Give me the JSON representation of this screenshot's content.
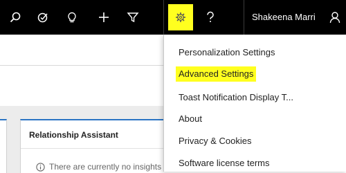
{
  "topbar": {
    "icons": [
      "search-icon",
      "tasks-icon",
      "lightbulb-icon",
      "plus-icon",
      "filter-icon",
      "gear-icon",
      "help-icon",
      "person-icon"
    ],
    "user_name": "Shakeena Marri",
    "gear_highlight_color": "#ffff1f"
  },
  "settings_menu": {
    "items": [
      {
        "label": "Personalization Settings"
      },
      {
        "label": "Advanced Settings",
        "highlighted": true
      },
      {
        "label": "Toast Notification Display T..."
      },
      {
        "label": "About"
      },
      {
        "label": "Privacy & Cookies"
      },
      {
        "label": "Software license terms"
      }
    ],
    "highlight_color": "#ffff1f"
  },
  "relationship_assistant": {
    "title": "Relationship Assistant",
    "message": "There are currently no insights"
  },
  "colors": {
    "topbar": "#000000",
    "panel_accent": "#2a74c4"
  }
}
